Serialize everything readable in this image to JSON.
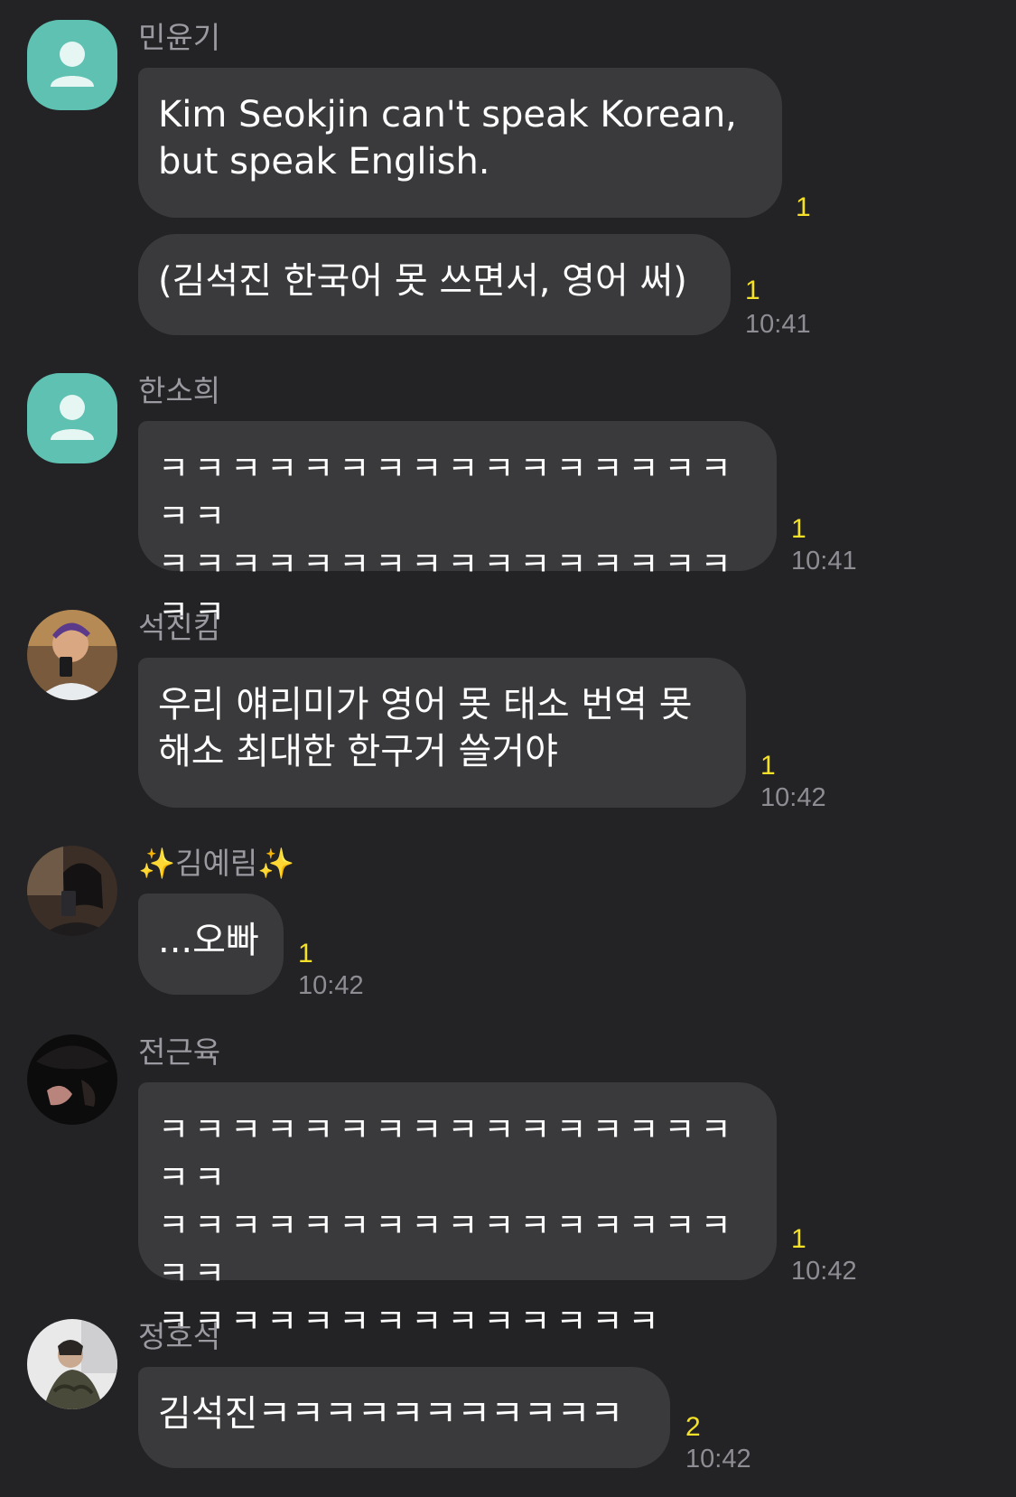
{
  "messages": [
    {
      "sender": "민윤기",
      "avatar": "default-person-icon",
      "bubbles": [
        {
          "text": "Kim Seokjin can't speak Korean,\nbut speak English.",
          "unread": "1",
          "time": ""
        },
        {
          "text": "(김석진 한국어 못 쓰면서, 영어 써)",
          "unread": "1",
          "time": "10:41"
        }
      ]
    },
    {
      "sender": "한소희",
      "avatar": "default-person-icon",
      "bubbles": [
        {
          "text": "ㅋㅋㅋㅋㅋㅋㅋㅋㅋㅋㅋㅋㅋㅋㅋㅋㅋㅋ\nㅋㅋㅋㅋㅋㅋㅋㅋㅋㅋㅋㅋㅋㅋㅋㅋㅋㅋ",
          "unread": "1",
          "time": "10:41"
        }
      ]
    },
    {
      "sender": "석진킴",
      "avatar": "profile-photo",
      "bubbles": [
        {
          "text": "우리 얘리미가 영어 못 태소 번역 못\n해소 최대한 한구거 쓸거야",
          "unread": "1",
          "time": "10:42"
        }
      ]
    },
    {
      "sender": "김예림",
      "sender_prefix": "✨",
      "sender_suffix": "✨",
      "avatar": "profile-photo",
      "bubbles": [
        {
          "text": "...오빠",
          "unread": "1",
          "time": "10:42"
        }
      ]
    },
    {
      "sender": "전근육",
      "avatar": "profile-photo",
      "bubbles": [
        {
          "text": "ㅋㅋㅋㅋㅋㅋㅋㅋㅋㅋㅋㅋㅋㅋㅋㅋㅋㅋ\nㅋㅋㅋㅋㅋㅋㅋㅋㅋㅋㅋㅋㅋㅋㅋㅋㅋㅋ\nㅋㅋㅋㅋㅋㅋㅋㅋㅋㅋㅋㅋㅋㅋ",
          "unread": "1",
          "time": "10:42"
        }
      ]
    },
    {
      "sender": "정호석",
      "avatar": "profile-photo",
      "bubbles": [
        {
          "text": "김석진ㅋㅋㅋㅋㅋㅋㅋㅋㅋㅋㅋ",
          "unread": "2",
          "time": "10:42"
        }
      ]
    }
  ],
  "colors": {
    "background": "#232325",
    "bubble": "#3a3a3d",
    "unread": "#f5e128",
    "default_avatar": "#5ec1b2"
  }
}
